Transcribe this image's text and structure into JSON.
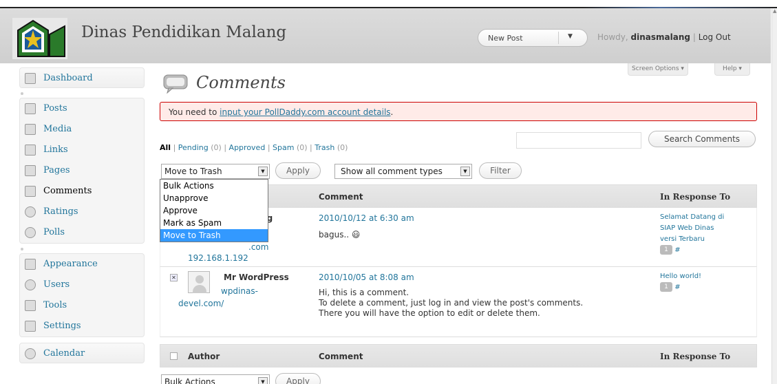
{
  "site": {
    "title": "Dinas Pendidikan Malang"
  },
  "header": {
    "new_post": "New Post",
    "howdy_prefix": "Howdy,",
    "username": "dinasmalang",
    "separator": "|",
    "logout": "Log Out"
  },
  "sidebar": {
    "items": [
      {
        "label": "Dashboard",
        "icon": "dashboard-icon"
      },
      {
        "label": "Posts",
        "icon": "posts-icon"
      },
      {
        "label": "Media",
        "icon": "media-icon"
      },
      {
        "label": "Links",
        "icon": "links-icon"
      },
      {
        "label": "Pages",
        "icon": "pages-icon"
      },
      {
        "label": "Comments",
        "icon": "comments-icon",
        "active": true
      },
      {
        "label": "Ratings",
        "icon": "ratings-icon"
      },
      {
        "label": "Polls",
        "icon": "polls-icon"
      },
      {
        "label": "Appearance",
        "icon": "appearance-icon"
      },
      {
        "label": "Users",
        "icon": "users-icon"
      },
      {
        "label": "Tools",
        "icon": "tools-icon"
      },
      {
        "label": "Settings",
        "icon": "settings-icon"
      },
      {
        "label": "Calendar",
        "icon": "calendar-icon"
      }
    ]
  },
  "page": {
    "title": "Comments",
    "screen_options": "Screen Options ▾",
    "help": "Help ▾"
  },
  "notice": {
    "prefix": "You need to ",
    "link": "input your PollDaddy.com account details",
    "suffix": "."
  },
  "filters": {
    "all": "All",
    "pending": "Pending",
    "pending_count": "(0)",
    "approved": "Approved",
    "spam": "Spam",
    "spam_count": "(0)",
    "trash": "Trash",
    "trash_count": "(0)",
    "sep": " | "
  },
  "search": {
    "button": "Search Comments",
    "value": ""
  },
  "actions": {
    "bulk_selected": "Move to Trash",
    "apply": "Apply",
    "type_filter": "Show all comment types",
    "filter": "Filter",
    "bulk_bottom": "Bulk Actions",
    "dropdown_options": [
      "Bulk Actions",
      "Unapprove",
      "Approve",
      "Mark as Spam",
      "Move to Trash"
    ]
  },
  "table": {
    "headers": {
      "author": "Author",
      "comment": "Comment",
      "response": "In Response To"
    },
    "rows": [
      {
        "author": "ang",
        "email": ".com",
        "ip": "192.168.1.192",
        "date": "2010/10/12 at 6:30 am",
        "text": "bagus.. 😃",
        "response": [
          "Selamat Datang di",
          "SIAP Web Dinas",
          "versi Terbaru"
        ],
        "count": "1",
        "hash": "#"
      },
      {
        "author": "Mr WordPress",
        "url_line1": "wpdinas-",
        "url_line2": "devel.com/",
        "date": "2010/10/05 at 8:08 am",
        "text": [
          "Hi, this is a comment.",
          "To delete a comment, just log in and view the post's comments.",
          "There you will have the option to edit or delete them."
        ],
        "response": [
          "Hello world!"
        ],
        "count": "1",
        "hash": "#"
      }
    ]
  },
  "colors": {
    "link": "#21759b",
    "notice_bg": "#ffebe8",
    "notice_border": "#cc0000",
    "selected": "#3399ff"
  }
}
